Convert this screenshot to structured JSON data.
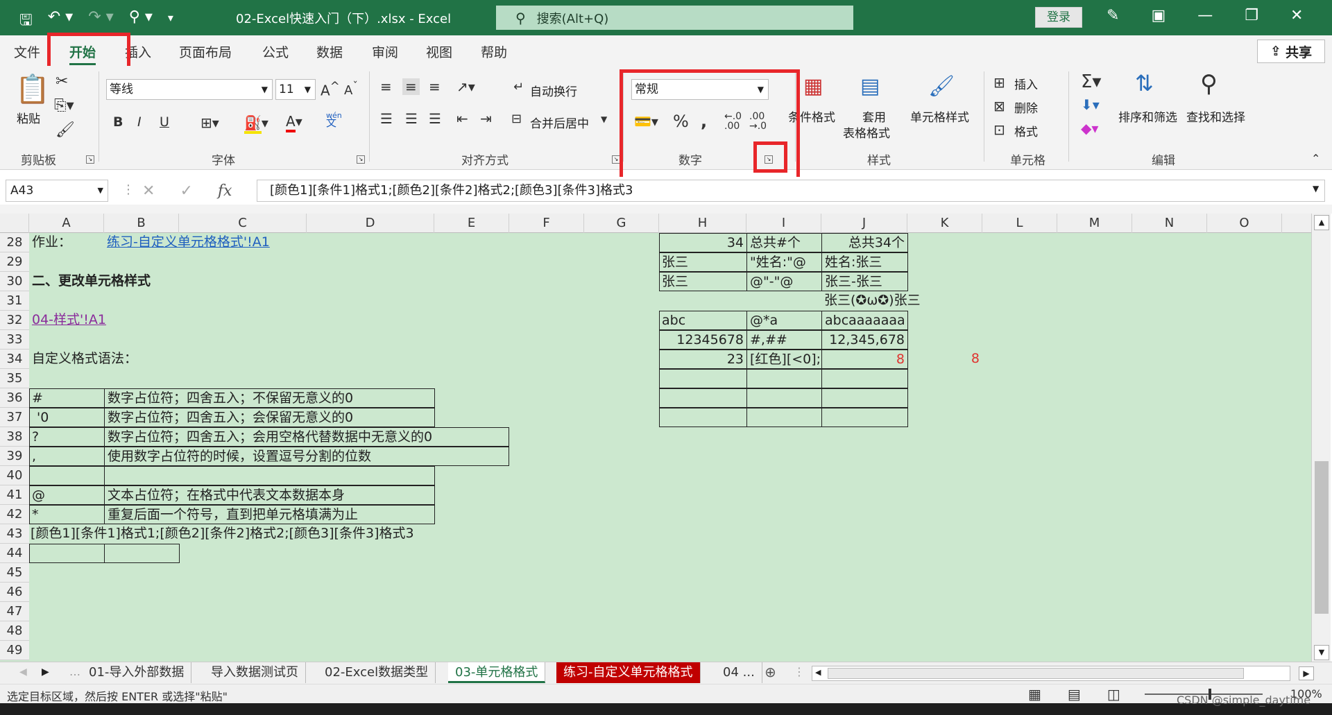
{
  "titlebar": {
    "title": "02-Excel快速入门（下）.xlsx  -  Excel",
    "search_placeholder": "搜索(Alt+Q)",
    "login": "登录"
  },
  "menu": {
    "tabs": [
      "文件",
      "开始",
      "插入",
      "页面布局",
      "公式",
      "数据",
      "审阅",
      "视图",
      "帮助"
    ],
    "active_tab": "开始",
    "share": "共享"
  },
  "ribbon": {
    "paste": "粘贴",
    "clipboard_label": "剪贴板",
    "font_name": "等线",
    "font_size": "11",
    "font_label": "字体",
    "wrap_text": "自动换行",
    "merge_center": "合并后居中",
    "align_label": "对齐方式",
    "number_format": "常规",
    "number_label": "数字",
    "cond_format": "条件格式",
    "table_format_1": "套用",
    "table_format_2": "表格格式",
    "cell_styles": "单元格样式",
    "styles_label": "样式",
    "insert": "插入",
    "delete": "删除",
    "format": "格式",
    "cells_label": "单元格",
    "sort_filter": "排序和筛选",
    "find_select": "查找和选择",
    "editing_label": "编辑",
    "bold": "B",
    "italic": "I",
    "underline": "U",
    "wen": "wén",
    "wen_char": "文"
  },
  "formula_bar": {
    "name_box": "A43",
    "content": "[颜色1][条件1]格式1;[颜色2][条件2]格式2;[颜色3][条件3]格式3",
    "fx": "fx"
  },
  "columns": [
    "A",
    "B",
    "C",
    "D",
    "E",
    "F",
    "G",
    "H",
    "I",
    "J",
    "K",
    "L",
    "M",
    "N",
    "O"
  ],
  "rows": [
    "28",
    "29",
    "30",
    "31",
    "32",
    "33",
    "34",
    "35",
    "36",
    "37",
    "38",
    "39",
    "40",
    "41",
    "42",
    "43",
    "44",
    "45",
    "46",
    "47",
    "48",
    "49"
  ],
  "cells": {
    "a28": "作业：",
    "b28": "练习-自定义单元格格式'!A1",
    "a30": "二、更改单元格样式",
    "a32": "04-样式'!A1",
    "a34": "自定义格式语法：",
    "a36": "#",
    "b36": "数字占位符；四舍五入；不保留无意义的0",
    "a37": "'0",
    "b37": "数字占位符；四舍五入；会保留无意义的0",
    "a38": "?",
    "b38": "数字占位符；四舍五入；会用空格代替数据中无意义的0",
    "a39": ",",
    "b39": "使用数字占位符的时候，设置逗号分割的位数",
    "a41": "@",
    "b41": "文本占位符；在格式中代表文本数据本身",
    "a42": "*",
    "b42": "重复后面一个符号，直到把单元格填满为止",
    "a43": "[颜色1][条件1]格式1;[颜色2][条件2]格式2;[颜色3][条件3]格式3",
    "h28": "34",
    "i28": "总共#个",
    "j28": "总共34个",
    "h29": "张三",
    "i29": "\"姓名:\"@",
    "j29": "姓名:张三",
    "h30": "张三",
    "i30": "@\"-\"@",
    "j30": "张三-张三",
    "j31": "张三(✪ω✪)张三",
    "h32": "abc",
    "i32": "@*a",
    "j32": "abcaaaaaaa",
    "h33": "12345678",
    "i33": "#,##",
    "j33": "12,345,678",
    "h34": "23",
    "i34": "[红色][<0];",
    "j34": "8",
    "k34": "8"
  },
  "sheet_tabs": [
    "01-导入外部数据",
    "导入数据测试页",
    "02-Excel数据类型",
    "03-单元格格式",
    "练习-自定义单元格格式",
    "04 ..."
  ],
  "active_sheet": "03-单元格格式",
  "status": {
    "message": "选定目标区域，然后按 ENTER 或选择\"粘贴\"",
    "zoom": "100%"
  },
  "watermark": "CSDN @simple_daytime",
  "colors": {
    "excel_green": "#217346",
    "sheet_bg": "#cce8cf",
    "highlight_red": "#e8262a"
  }
}
